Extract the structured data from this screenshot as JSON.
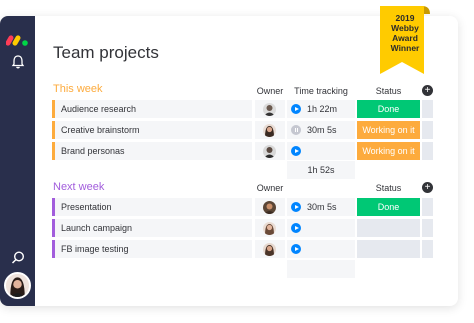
{
  "page": {
    "title": "Team projects"
  },
  "award": {
    "lines": [
      "2019",
      "Webby",
      "Award",
      "Winner"
    ]
  },
  "columns": {
    "owner": "Owner",
    "time": "Time tracking",
    "status": "Status"
  },
  "groups": [
    {
      "title": "This week",
      "color": "#fdab3d",
      "rows": [
        {
          "name": "Audience research",
          "time": "1h 22m",
          "timer": "play",
          "status": "Done",
          "status_kind": "done"
        },
        {
          "name": "Creative brainstorm",
          "time": "30m 5s",
          "timer": "pause",
          "status": "Working on it",
          "status_kind": "working"
        },
        {
          "name": "Brand personas",
          "time": "",
          "timer": "play",
          "status": "Working on it",
          "status_kind": "working"
        }
      ],
      "total": "1h 52s"
    },
    {
      "title": "Next week",
      "color": "#a25ddc",
      "rows": [
        {
          "name": "Presentation",
          "time": "30m 5s",
          "timer": "play",
          "status": "Done",
          "status_kind": "done"
        },
        {
          "name": "Launch campaign",
          "time": "",
          "timer": "play",
          "status": "",
          "status_kind": "empty"
        },
        {
          "name": "FB image testing",
          "time": "",
          "timer": "play",
          "status": "",
          "status_kind": "empty"
        }
      ]
    }
  ],
  "icons": {
    "logo": "monday-logo-icon",
    "bell": "bell-icon",
    "search": "search-icon",
    "add": "add-column-icon"
  },
  "colors": {
    "sidebar": "#292f4c",
    "done": "#00c875",
    "working": "#fdab3d",
    "purple": "#a25ddc",
    "award": "#ffcb00",
    "play": "#0085ff"
  }
}
